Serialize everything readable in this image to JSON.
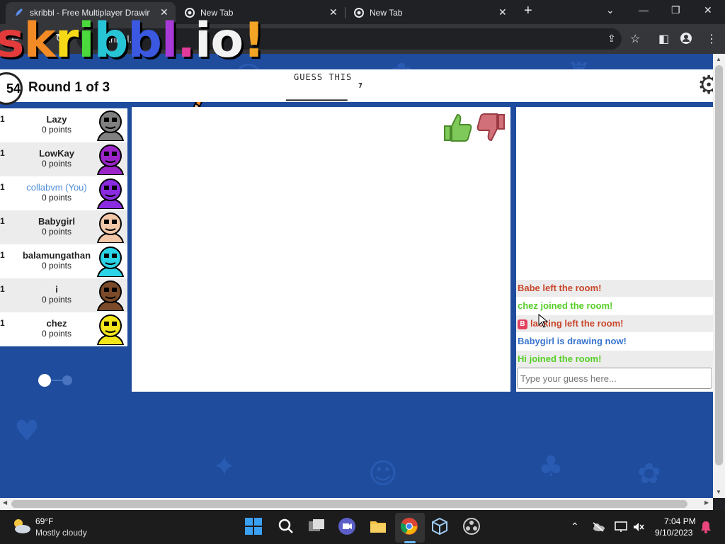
{
  "browser": {
    "tabs": [
      {
        "label": "skribbl - Free Multiplayer Drawing",
        "icon": "pencil-icon",
        "active": true
      },
      {
        "label": "New Tab",
        "icon": "chrome-icon",
        "active": false
      },
      {
        "label": "New Tab",
        "icon": "chrome-icon",
        "active": false
      }
    ],
    "url": "skribbl.io"
  },
  "game": {
    "logo": "skribbl.io",
    "timer": "54",
    "round": "Round 1 of 3",
    "guess_label": "GUESS THIS",
    "word_blanks": "_______",
    "word_length": "7",
    "players": [
      {
        "rank": "1",
        "name": "Lazy",
        "points": "0 points",
        "color": "#808080",
        "you": false,
        "drawing": false
      },
      {
        "rank": "1",
        "name": "LowKay",
        "points": "0 points",
        "color": "#9b25c8",
        "you": false,
        "drawing": false
      },
      {
        "rank": "1",
        "name": "collabvm (You)",
        "points": "0 points",
        "color": "#8a2be2",
        "you": true,
        "drawing": false
      },
      {
        "rank": "1",
        "name": "Babygirl",
        "points": "0 points",
        "color": "#f1c7a8",
        "you": false,
        "drawing": true
      },
      {
        "rank": "1",
        "name": "balamungathan",
        "points": "0 points",
        "color": "#2bd3e6",
        "you": false,
        "drawing": false
      },
      {
        "rank": "1",
        "name": "i",
        "points": "0 points",
        "color": "#7a4a2a",
        "you": false,
        "drawing": false
      },
      {
        "rank": "1",
        "name": "chez",
        "points": "0 points",
        "color": "#f2e51b",
        "you": false,
        "drawing": false
      }
    ],
    "chat": [
      {
        "text": "Babe left the room!",
        "color": "#c9462b"
      },
      {
        "text": "chez joined the room!",
        "color": "#56ce27"
      },
      {
        "text": "lacking left the room!",
        "color": "#c9462b",
        "badge": "B"
      },
      {
        "text": "Babygirl is drawing now!",
        "color": "#3975ce"
      },
      {
        "text": "Hi joined the room!",
        "color": "#56ce27"
      }
    ],
    "guess_placeholder": "Type your guess here..."
  },
  "taskbar": {
    "weather_temp": "69°F",
    "weather_desc": "Mostly cloudy",
    "time": "7:04 PM",
    "date": "9/10/2023"
  }
}
